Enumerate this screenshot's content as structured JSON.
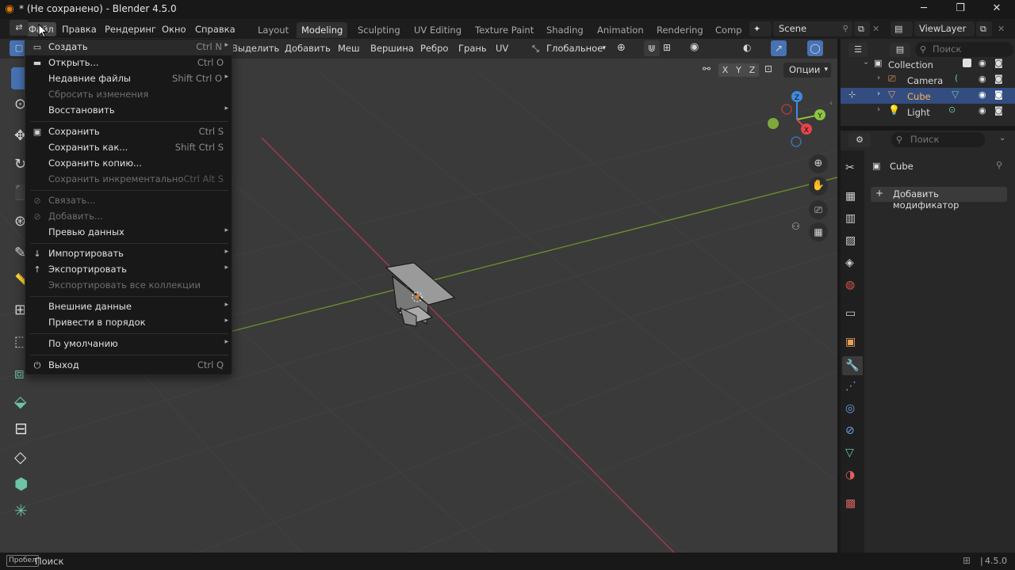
{
  "window": {
    "title": "* (Не сохранено) - Blender 4.5.0",
    "minimize": "─",
    "maximize": "❐",
    "close": "✕"
  },
  "topbar": {
    "menus": [
      "Файл",
      "Правка",
      "Рендеринг",
      "Окно",
      "Справка"
    ],
    "workspaces": [
      "Layout",
      "Modeling",
      "Sculpting",
      "UV Editing",
      "Texture Paint",
      "Shading",
      "Animation",
      "Rendering",
      "Comp"
    ],
    "active_workspace": "Modeling",
    "scene": "Scene",
    "view_layer": "ViewLayer"
  },
  "viewport_header": {
    "menus": [
      "Выделить",
      "Добавить",
      "Меш",
      "Вершина",
      "Ребро",
      "Грань",
      "UV"
    ],
    "orientation": "Глобальное",
    "options": "Опции",
    "axis_x": "X",
    "axis_y": "Y",
    "axis_z": "Z"
  },
  "gizmo": {
    "x": "X",
    "y": "Y",
    "z": "Z",
    "colors": {
      "x": "#e5434d",
      "y": "#8cc63f",
      "z": "#3f8ae0"
    }
  },
  "file_menu": {
    "items": [
      {
        "label": "Создать",
        "shortcut": "Ctrl N",
        "submenu": true,
        "disabled": false,
        "icon": "file-new-icon",
        "glyph": "▭"
      },
      {
        "label": "Открыть...",
        "shortcut": "Ctrl O",
        "submenu": false,
        "disabled": false,
        "icon": "folder-icon",
        "glyph": "▬"
      },
      {
        "label": "Недавние файлы",
        "shortcut": "Shift Ctrl O",
        "submenu": true,
        "disabled": false,
        "icon": "",
        "glyph": ""
      },
      {
        "label": "Сбросить изменения",
        "shortcut": "",
        "submenu": false,
        "disabled": true,
        "icon": "",
        "glyph": ""
      },
      {
        "label": "Восстановить",
        "shortcut": "",
        "submenu": true,
        "disabled": false,
        "icon": "",
        "glyph": ""
      },
      {
        "label": "Сохранить",
        "shortcut": "Ctrl S",
        "submenu": false,
        "disabled": false,
        "icon": "save-icon",
        "glyph": "▣"
      },
      {
        "label": "Сохранить как...",
        "shortcut": "Shift Ctrl S",
        "submenu": false,
        "disabled": false,
        "icon": "",
        "glyph": ""
      },
      {
        "label": "Сохранить копию...",
        "shortcut": "",
        "submenu": false,
        "disabled": false,
        "icon": "",
        "glyph": ""
      },
      {
        "label": "Сохранить инкрементально",
        "shortcut": "Ctrl Alt S",
        "submenu": false,
        "disabled": true,
        "icon": "",
        "glyph": ""
      },
      {
        "label": "Связать...",
        "shortcut": "",
        "submenu": false,
        "disabled": true,
        "icon": "link-icon",
        "glyph": "⊘"
      },
      {
        "label": "Добавить...",
        "shortcut": "",
        "submenu": false,
        "disabled": true,
        "icon": "append-icon",
        "glyph": "⊘"
      },
      {
        "label": "Превью данных",
        "shortcut": "",
        "submenu": true,
        "disabled": false,
        "icon": "",
        "glyph": ""
      },
      {
        "label": "Импортировать",
        "shortcut": "",
        "submenu": true,
        "disabled": false,
        "icon": "import-icon",
        "glyph": "↓"
      },
      {
        "label": "Экспортировать",
        "shortcut": "",
        "submenu": true,
        "disabled": false,
        "icon": "export-icon",
        "glyph": "↑"
      },
      {
        "label": "Экспортировать все коллекции",
        "shortcut": "",
        "submenu": false,
        "disabled": true,
        "icon": "",
        "glyph": ""
      },
      {
        "label": "Внешние данные",
        "shortcut": "",
        "submenu": true,
        "disabled": false,
        "icon": "",
        "glyph": ""
      },
      {
        "label": "Привести в порядок",
        "shortcut": "",
        "submenu": true,
        "disabled": false,
        "icon": "",
        "glyph": ""
      },
      {
        "label": "По умолчанию",
        "shortcut": "",
        "submenu": true,
        "disabled": false,
        "icon": "",
        "glyph": ""
      },
      {
        "label": "Выход",
        "shortcut": "Ctrl Q",
        "submenu": false,
        "disabled": false,
        "icon": "power-icon",
        "glyph": "⏻"
      }
    ]
  },
  "outliner": {
    "search_placeholder": "Поиск",
    "items": [
      {
        "label": "Collection",
        "icon": "collection-icon"
      },
      {
        "label": "Camera",
        "icon": "camera-icon"
      },
      {
        "label": "Cube",
        "icon": "mesh-icon",
        "selected": true
      },
      {
        "label": "Light",
        "icon": "light-icon"
      }
    ]
  },
  "properties": {
    "search_placeholder": "Поиск",
    "object_name": "Cube",
    "add_modifier": "Добавить модификатор"
  },
  "statusbar": {
    "key": "Пробел",
    "action": "Поиск",
    "version": "4.5.0"
  }
}
